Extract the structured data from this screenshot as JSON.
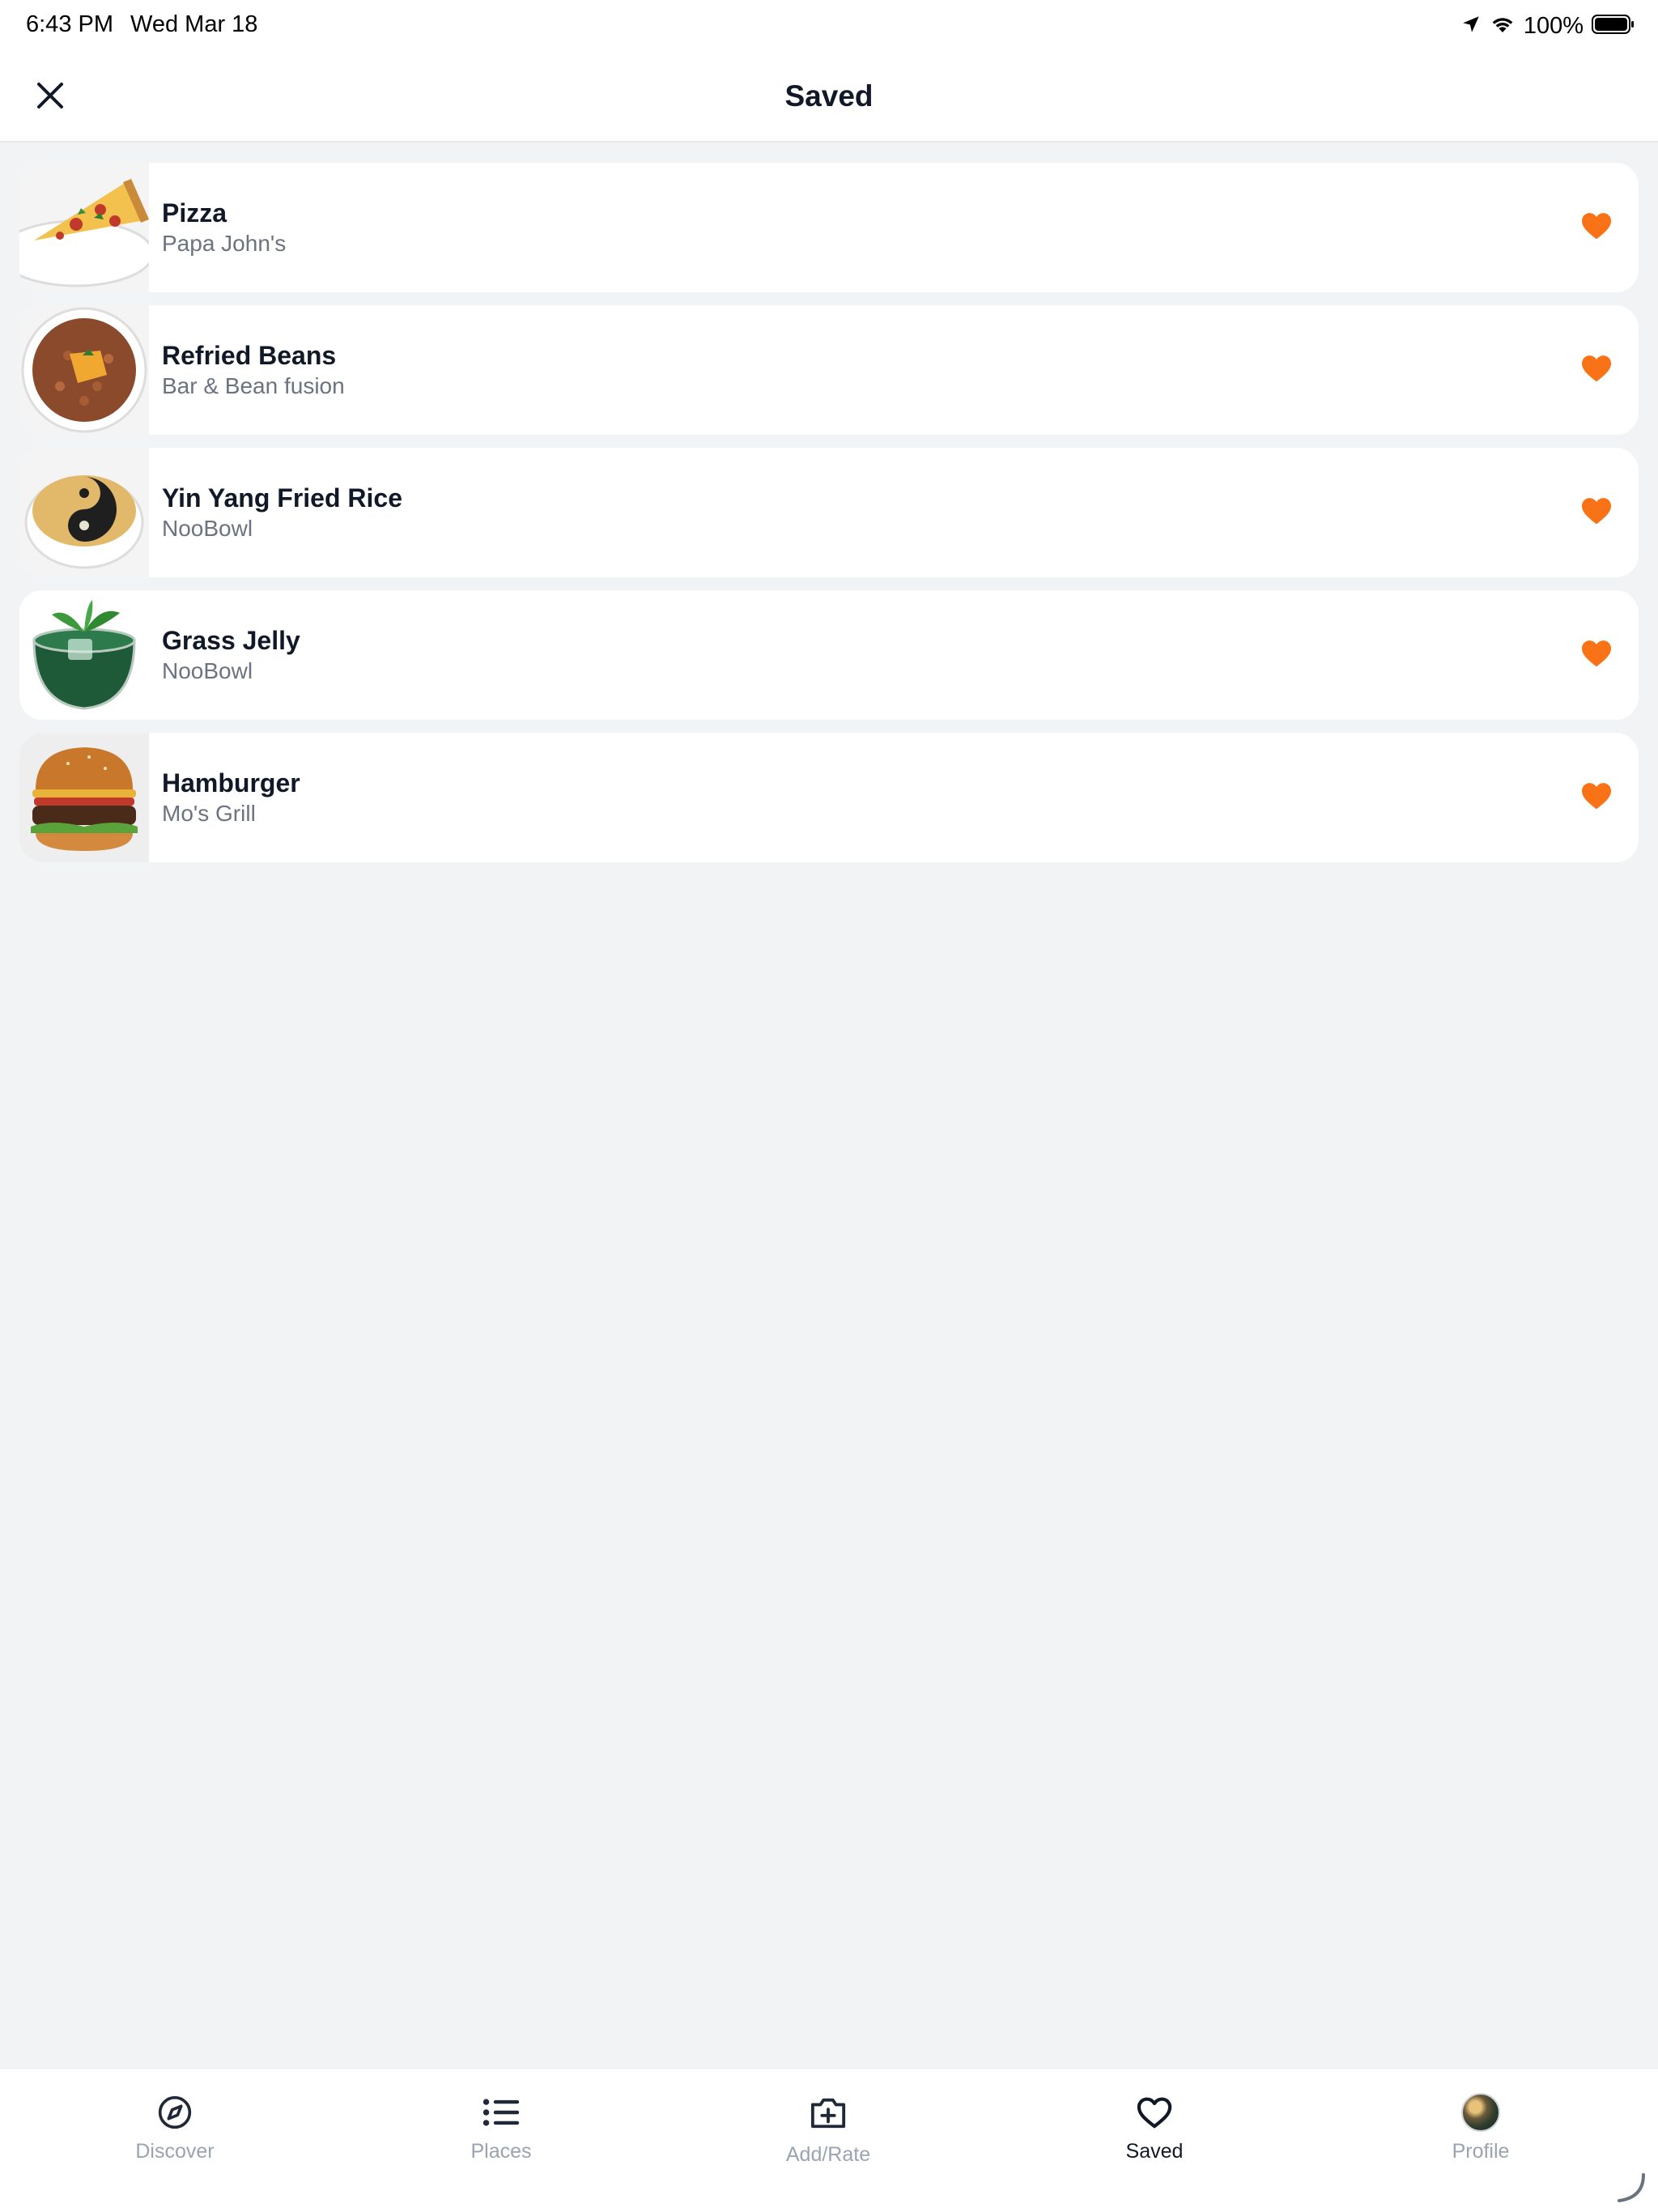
{
  "status_bar": {
    "time": "6:43 PM",
    "date": "Wed Mar 18",
    "battery": "100%",
    "icons": [
      "location-arrow-icon",
      "wifi-icon",
      "battery-icon"
    ]
  },
  "header": {
    "title": "Saved",
    "close_icon": "close-icon"
  },
  "saved_items": [
    {
      "name": "Pizza",
      "place": "Papa John's",
      "image": "pizza-slice",
      "favorited": true
    },
    {
      "name": "Refried Beans",
      "place": "Bar & Bean fusion",
      "image": "beans-bowl",
      "favorited": true
    },
    {
      "name": "Yin Yang Fried Rice",
      "place": "NooBowl",
      "image": "yin-yang-rice-bowl",
      "favorited": true
    },
    {
      "name": "Grass Jelly",
      "place": "NooBowl",
      "image": "grass-jelly-glass",
      "favorited": true
    },
    {
      "name": "Hamburger",
      "place": "Mo's Grill",
      "image": "hamburger",
      "favorited": true
    }
  ],
  "tabs": [
    {
      "label": "Discover",
      "icon": "compass-icon",
      "active": false
    },
    {
      "label": "Places",
      "icon": "list-icon",
      "active": false
    },
    {
      "label": "Add/Rate",
      "icon": "camera-plus-icon",
      "active": false
    },
    {
      "label": "Saved",
      "icon": "heart-outline-icon",
      "active": true
    },
    {
      "label": "Profile",
      "icon": "avatar",
      "active": false
    }
  ],
  "colors": {
    "accent": "#f97316",
    "background": "#f2f3f5",
    "card": "#ffffff",
    "text_primary": "#111827",
    "text_secondary": "#6b7280",
    "tab_inactive": "#9aa3b2"
  }
}
